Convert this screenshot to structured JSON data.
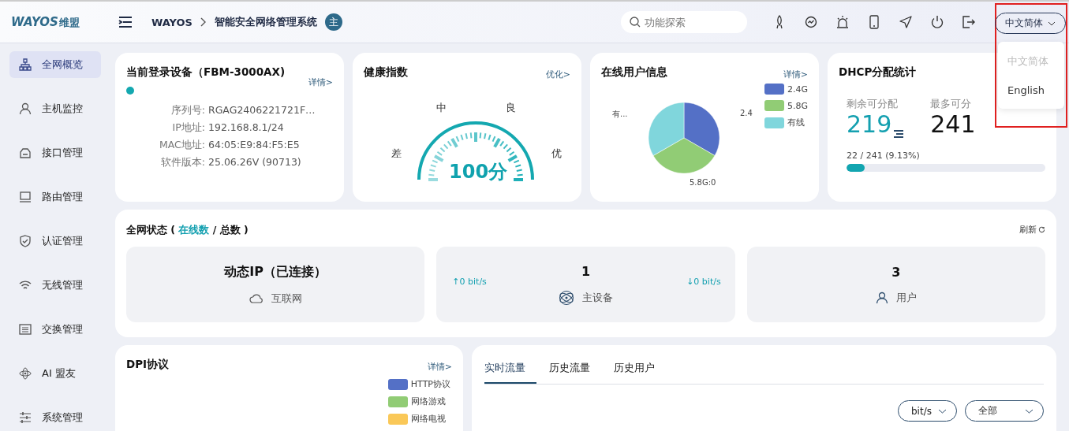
{
  "logo": {
    "text": "WAYOS",
    "suffix": "维盟"
  },
  "breadcrumb": [
    "WAYOS",
    "智能安全网络管理系统"
  ],
  "mode_badge": "主",
  "search": {
    "placeholder": "功能探索"
  },
  "language": {
    "value": "中文简体",
    "options": [
      {
        "label": "中文简体",
        "selected": true
      },
      {
        "label": "English",
        "selected": false
      }
    ]
  },
  "sidebar": {
    "items": [
      {
        "label": "全网概览",
        "selected": true,
        "kind": "topology"
      },
      {
        "label": "主机监控",
        "selected": false,
        "kind": "user"
      },
      {
        "label": "接口管理",
        "selected": false,
        "kind": "port"
      },
      {
        "label": "路由管理",
        "selected": false,
        "kind": "laptop"
      },
      {
        "label": "认证管理",
        "selected": false,
        "kind": "shield"
      },
      {
        "label": "无线管理",
        "selected": false,
        "kind": "wifi"
      },
      {
        "label": "交换管理",
        "selected": false,
        "kind": "switch"
      },
      {
        "label": "AI 盟友",
        "selected": false,
        "kind": "atom"
      },
      {
        "label": "系统管理",
        "selected": false,
        "kind": "sliders"
      }
    ]
  },
  "device_card": {
    "title": "当前登录设备（FBM-3000AX)",
    "link": "详情>",
    "fields": [
      {
        "label": "序列号:",
        "value": "RGAG2406221721F…"
      },
      {
        "label": "IP地址:",
        "value": "192.168.8.1/24"
      },
      {
        "label": "MAC地址:",
        "value": "64:05:E9:84:F5:E5"
      },
      {
        "label": "软件版本:",
        "value": "25.06.26V (90713)"
      }
    ]
  },
  "health_card": {
    "title": "健康指数",
    "link": "优化>",
    "grades": [
      "差",
      "中",
      "良",
      "优"
    ],
    "score": "100分"
  },
  "users_card": {
    "title": "在线用户信息",
    "link": "详情>",
    "slice_labels": [
      "2.4",
      "5.8G:0",
      "有..."
    ],
    "legend": [
      {
        "label": "2.4G",
        "color": "#5470c6"
      },
      {
        "label": "5.8G",
        "color": "#91cc75"
      },
      {
        "label": "有线",
        "color": "#80d6dc"
      }
    ]
  },
  "dhcp_card": {
    "title": "DHCP分配统计",
    "remaining_label": "剩余可分配",
    "remaining": "219",
    "max_label": "最多可分",
    "max": "241",
    "usage": "22 / 241 (9.13%)",
    "level": 0.0913
  },
  "network_status": {
    "title": "全网状态 ( **在线数** / 总数 )",
    "refresh": "刷新",
    "tiles": [
      {
        "kind": "internet",
        "value": "动态IP（已连接）",
        "label": "互联网"
      },
      {
        "kind": "device",
        "value": "1",
        "label": "主设备",
        "up": "↑0 bit/s",
        "down": "↓0 bit/s"
      },
      {
        "kind": "users",
        "value": "3",
        "label": "用户"
      }
    ]
  },
  "dpi_card": {
    "title": "DPI协议",
    "link": "详情>",
    "legend": [
      {
        "label": "HTTP协议",
        "color": "#5470c6"
      },
      {
        "label": "网络游戏",
        "color": "#91cc75"
      },
      {
        "label": "网络电视",
        "color": "#fac858"
      }
    ]
  },
  "traffic_card": {
    "tabs": [
      {
        "label": "实时流量",
        "selected": true
      },
      {
        "label": "历史流量",
        "selected": false
      },
      {
        "label": "历史用户",
        "selected": false
      }
    ],
    "unit": "bit/s",
    "scope": "全部"
  }
}
